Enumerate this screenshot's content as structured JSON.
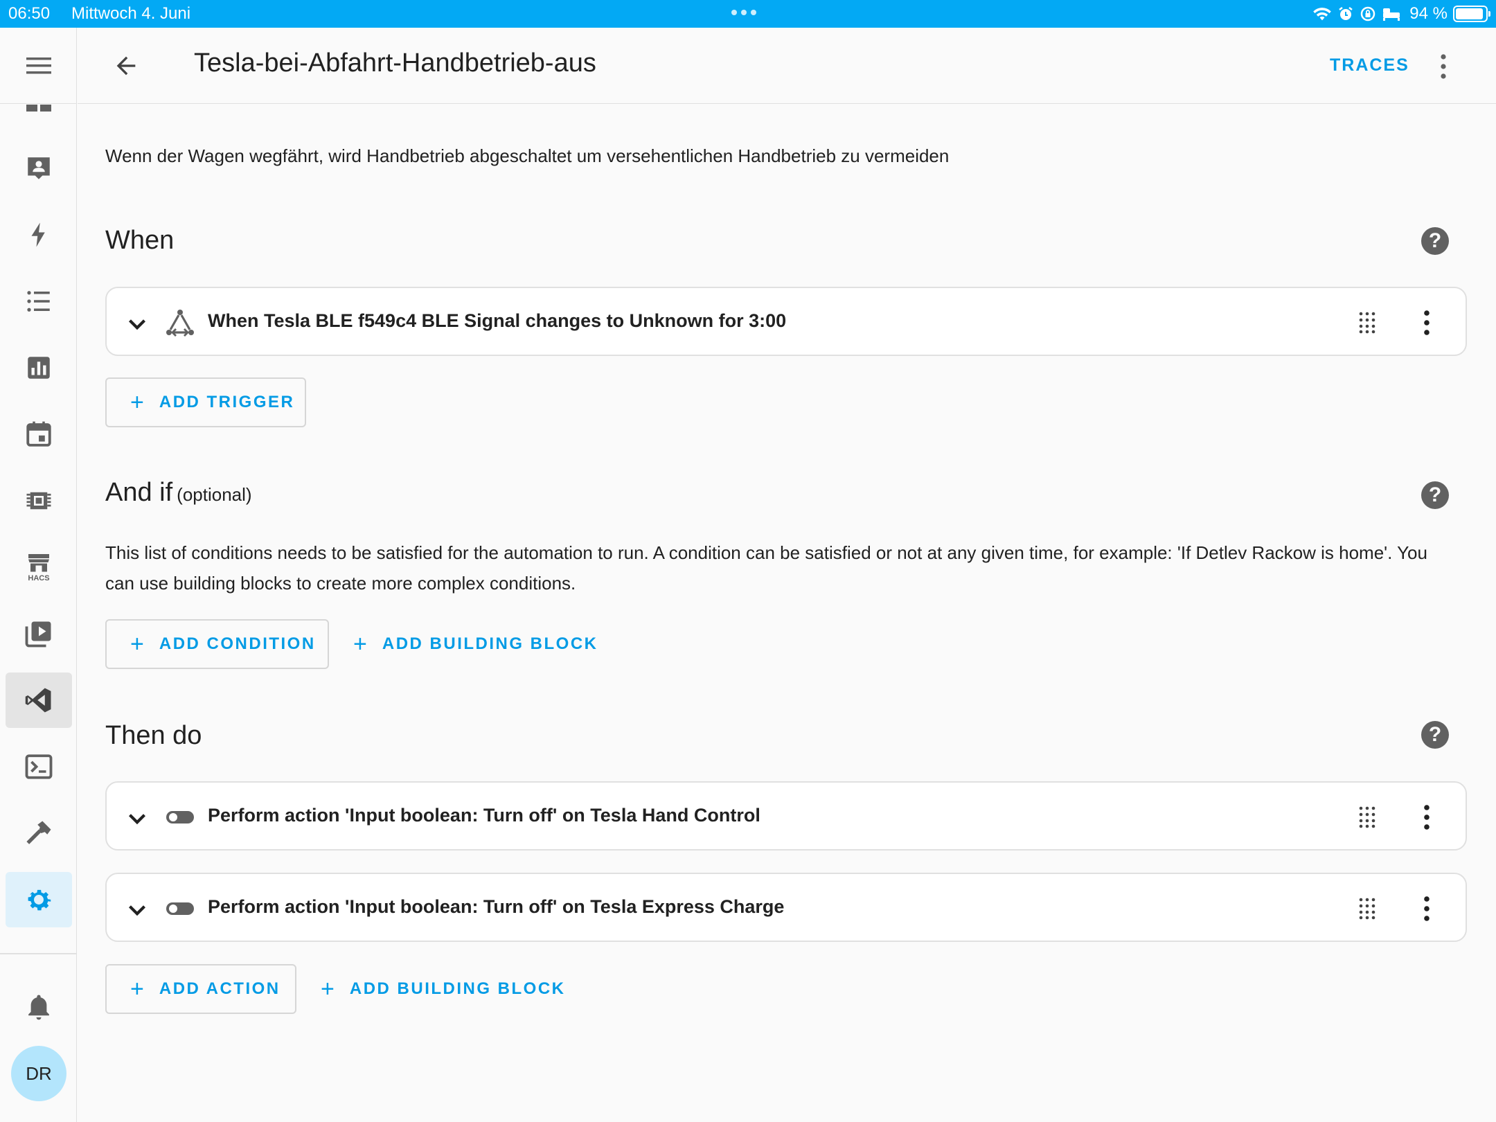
{
  "status_bar": {
    "time": "06:50",
    "date": "Mittwoch 4. Juni",
    "battery": "94 %",
    "battery_level": 0.94
  },
  "sidebar": {
    "menu_icon": "menu-icon",
    "items": [
      {
        "icon": "dashboard-icon"
      },
      {
        "icon": "person-board-icon"
      },
      {
        "icon": "energy-icon"
      },
      {
        "icon": "list-icon"
      },
      {
        "icon": "history-icon"
      },
      {
        "icon": "calendar-icon"
      },
      {
        "icon": "esphome-chip-icon"
      },
      {
        "icon": "hacs-icon",
        "badge": "HACS"
      },
      {
        "icon": "media-icon"
      },
      {
        "icon": "vscode-icon"
      },
      {
        "icon": "terminal-icon"
      },
      {
        "icon": "developer-tools-icon"
      },
      {
        "icon": "settings-icon"
      }
    ],
    "notifications_icon": "bell-icon",
    "avatar_initials": "DR"
  },
  "header": {
    "title": "Tesla-bei-Abfahrt-Handbetrieb-aus",
    "traces_label": "TRACES"
  },
  "main": {
    "description": "Wenn der Wagen wegfährt, wird Handbetrieb abgeschaltet um versehentlichen Handbetrieb zu vermeiden",
    "when": {
      "title": "When",
      "triggers": [
        {
          "label": "When Tesla BLE f549c4 BLE Signal changes to Unknown for 3:00",
          "icon": "state-trigger-icon"
        }
      ],
      "add_trigger_label": "ADD TRIGGER"
    },
    "and_if": {
      "title": "And if",
      "optional": "(optional)",
      "description": "This list of conditions needs to be satisfied for the automation to run. A condition can be satisfied or not at any given time, for example: 'If Detlev Rackow is home'. You can use building blocks to create more complex conditions.",
      "add_condition_label": "ADD CONDITION",
      "add_building_block_label": "ADD BUILDING BLOCK"
    },
    "then_do": {
      "title": "Then do",
      "actions": [
        {
          "label": "Perform action 'Input boolean: Turn off' on Tesla Hand Control",
          "icon": "toggle-icon"
        },
        {
          "label": "Perform action 'Input boolean: Turn off' on Tesla Express Charge",
          "icon": "toggle-icon"
        }
      ],
      "add_action_label": "ADD ACTION",
      "add_building_block_label": "ADD BUILDING BLOCK"
    }
  },
  "colors": {
    "primary": "#03a9f4",
    "accent_text": "#039be5"
  }
}
